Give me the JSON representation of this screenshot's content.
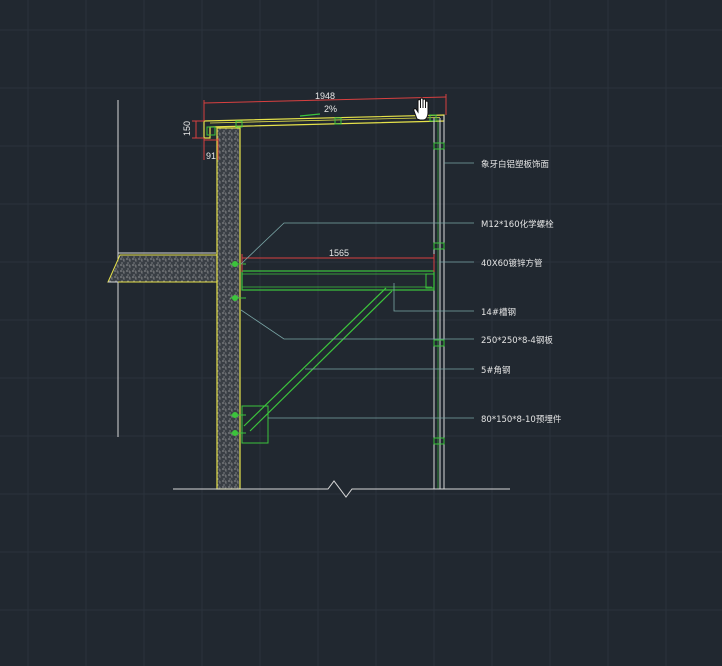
{
  "drawing": {
    "dimensions": {
      "top_width": "1948",
      "slope": "2%",
      "height_left": "150",
      "small": "91",
      "beam_length": "1565"
    },
    "labels": {
      "cladding": "象牙白铝塑板饰面",
      "bolt": "M12*160化学螺栓",
      "tube": "40X60镀锌方管",
      "channel": "14#槽钢",
      "plate": "250*250*8-4钢板",
      "angle": "5#角钢",
      "embed": "80*150*8-10预埋件"
    }
  },
  "colors": {
    "background": "#212830",
    "grid": "#2a323c",
    "concrete_outline": "#e6e24a",
    "steel": "#3cc43c",
    "dimension": "#d84040",
    "leader": "#7aa6a6",
    "line": "#d8d8d8"
  },
  "cursor": "pan-hand-icon"
}
